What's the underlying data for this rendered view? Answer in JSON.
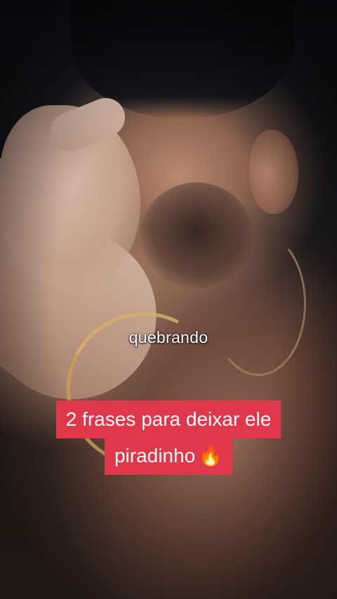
{
  "video": {
    "subtitle": "quebrando",
    "caption": {
      "line1": "2 frases para deixar ele",
      "line2": "piradinho",
      "emoji": "🔥",
      "background_color": "#e0374a",
      "text_color": "#ffffff"
    }
  }
}
